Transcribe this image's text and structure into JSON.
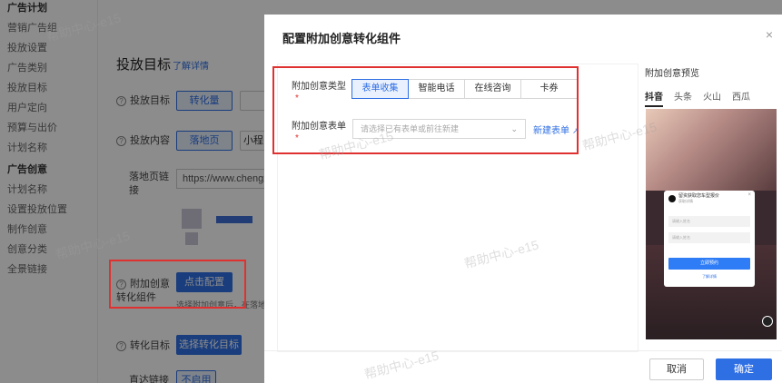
{
  "sidebar": {
    "items": [
      {
        "label": "广告计划",
        "head": true
      },
      {
        "label": "营销广告组"
      },
      {
        "label": "投放设置"
      },
      {
        "label": "广告类别"
      },
      {
        "label": "投放目标"
      },
      {
        "label": "用户定向"
      },
      {
        "label": "预算与出价"
      },
      {
        "label": "计划名称"
      },
      {
        "label": "广告创意",
        "head": true
      },
      {
        "label": "计划名称"
      },
      {
        "label": "设置投放位置"
      },
      {
        "label": "制作创意"
      },
      {
        "label": "创意分类"
      },
      {
        "label": "全景链接"
      }
    ]
  },
  "background": {
    "title": "投放目标",
    "learn_more": "了解详情",
    "goal_label": "投放目标",
    "goal_btn": "转化量",
    "content_label": "投放内容",
    "content_btn": "落地页",
    "content_btn2": "小程",
    "landing_label": "落地页链接",
    "landing_value": "https://www.chengzija",
    "addon_label": "附加创意转化组件",
    "addon_btn": "点击配置",
    "addon_hint": "选择附加创意后，在落地页",
    "convert_label": "转化目标",
    "convert_btn": "选择转化目标",
    "deep_label": "直达链接",
    "deep_btn": "不启用"
  },
  "modal": {
    "title": "配置附加创意转化组件",
    "close": "×",
    "type_label": "附加创意类型",
    "type_options": [
      "表单收集",
      "智能电话",
      "在线咨询",
      "卡券"
    ],
    "type_selected": 0,
    "form_label": "附加创意表单",
    "form_placeholder": "请选择已有表单或前往新建",
    "new_form_link": "新建表单",
    "cancel": "取消",
    "confirm": "确定"
  },
  "preview": {
    "title": "附加创意预览",
    "tabs": [
      "抖音",
      "头条",
      "火山",
      "西瓜"
    ],
    "active_tab": 0,
    "card": {
      "title": "留资获取您车型报价",
      "subtitle": "获取详情",
      "input1": "请输入姓名",
      "input2": "请输入姓名",
      "button": "立即预约",
      "more": "了解详情"
    }
  },
  "watermark": "帮助中心-e15",
  "watermark_small": "帮助中心"
}
